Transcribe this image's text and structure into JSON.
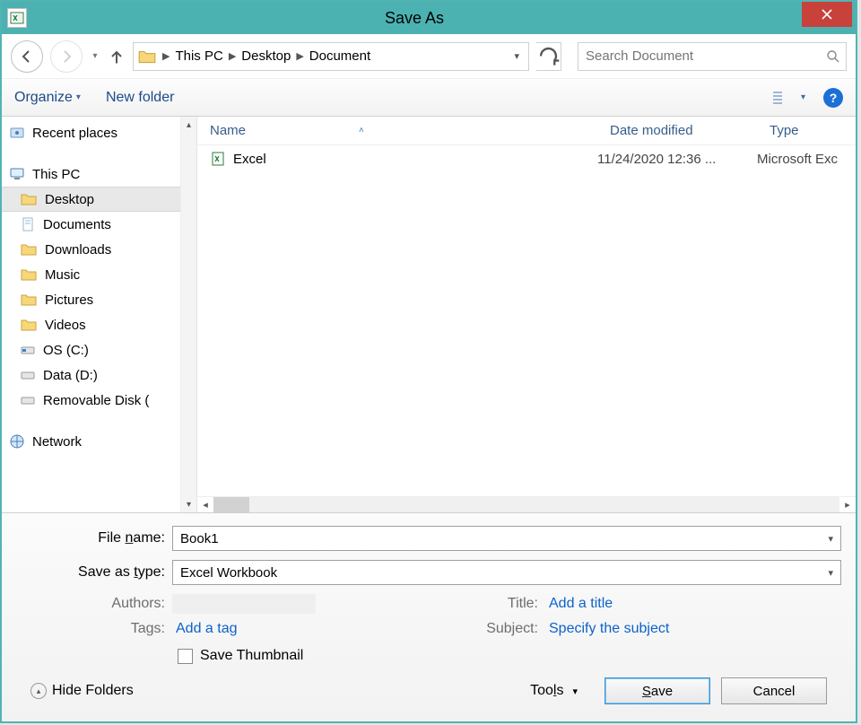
{
  "titlebar": {
    "title": "Save As"
  },
  "nav": {
    "breadcrumb": [
      "This PC",
      "Desktop",
      "Document"
    ],
    "search_placeholder": "Search Document"
  },
  "toolbar": {
    "organize": "Organize",
    "new_folder": "New folder"
  },
  "tree": {
    "recent_places": "Recent places",
    "this_pc": "This PC",
    "desktop": "Desktop",
    "documents": "Documents",
    "downloads": "Downloads",
    "music": "Music",
    "pictures": "Pictures",
    "videos": "Videos",
    "osc": "OS (C:)",
    "datad": "Data (D:)",
    "removable": "Removable Disk (",
    "network": "Network"
  },
  "filelist": {
    "headers": {
      "name": "Name",
      "date": "Date modified",
      "type": "Type"
    },
    "rows": [
      {
        "name": "Excel",
        "date": "11/24/2020 12:36 ...",
        "type": "Microsoft Exc"
      }
    ]
  },
  "form": {
    "filename_label": "File name:",
    "filename_value": "Book1",
    "saveastype_label": "Save as type:",
    "saveastype_value": "Excel Workbook",
    "authors_label": "Authors:",
    "tags_label": "Tags:",
    "tags_value": "Add a tag",
    "title_label": "Title:",
    "title_value": "Add a title",
    "subject_label": "Subject:",
    "subject_value": "Specify the subject",
    "save_thumbnail": "Save Thumbnail"
  },
  "footer": {
    "hide_folders": "Hide Folders",
    "tools": "Tools",
    "save": "Save",
    "cancel": "Cancel"
  }
}
